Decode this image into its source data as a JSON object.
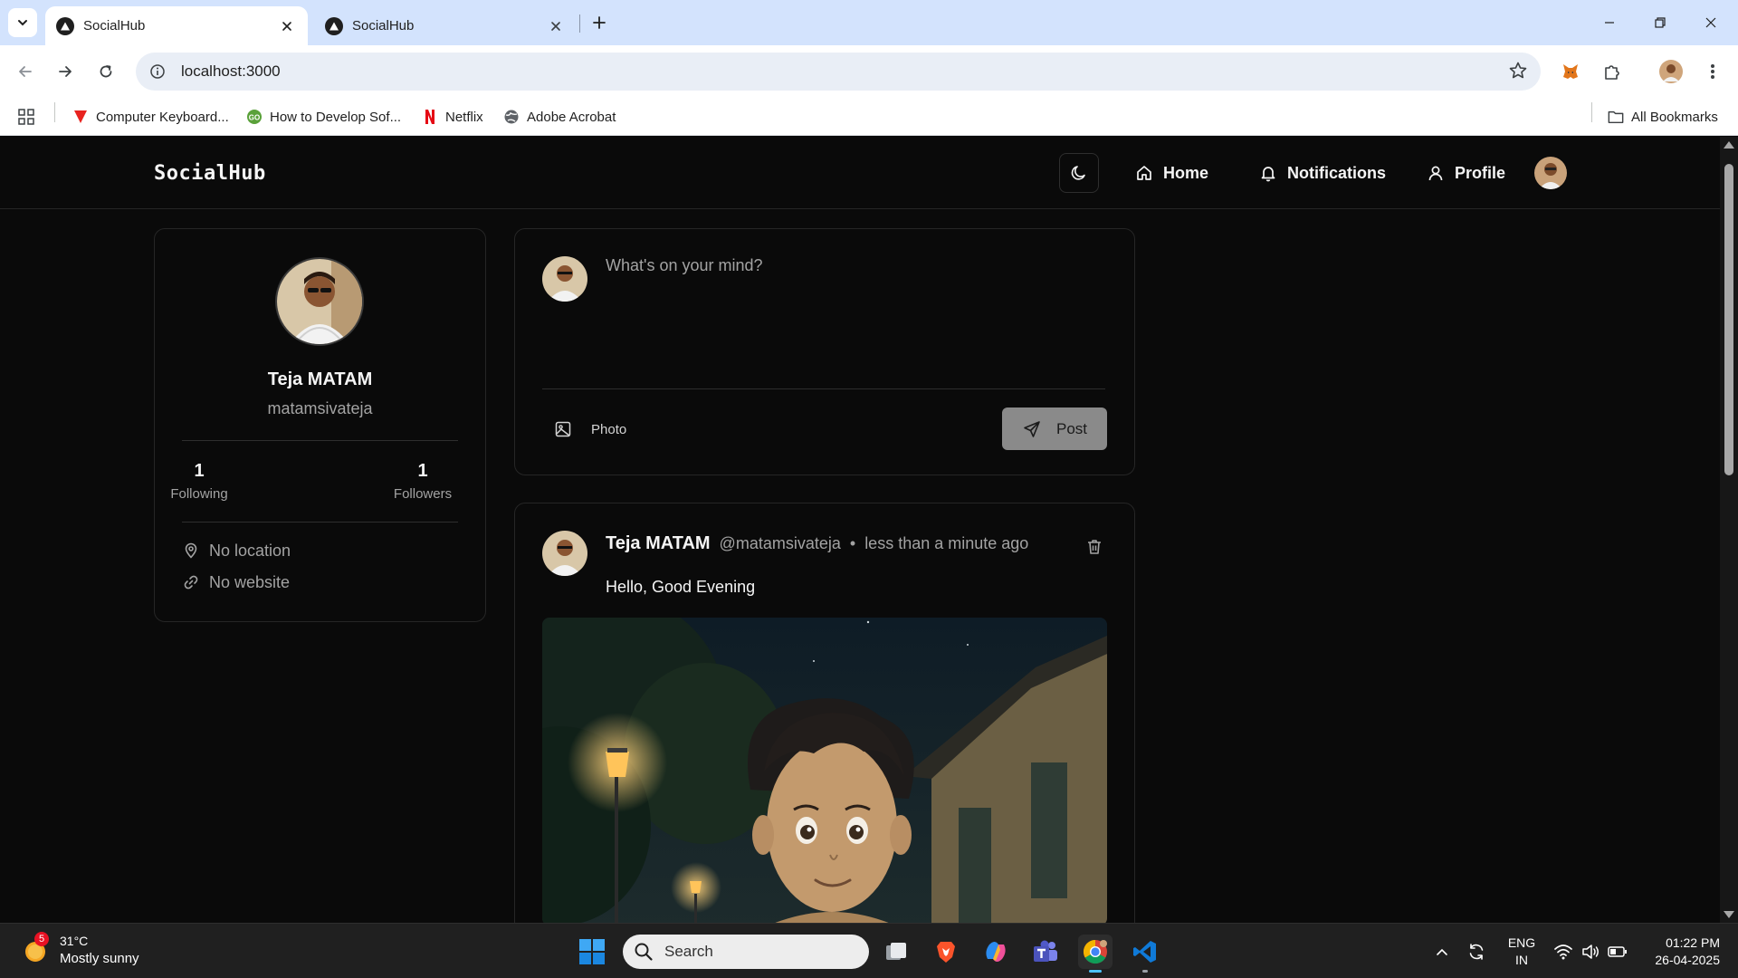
{
  "browser": {
    "tabs": [
      {
        "title": "SocialHub",
        "active": true
      },
      {
        "title": "SocialHub",
        "active": false
      }
    ],
    "url": "localhost:3000",
    "bookmarks": [
      {
        "label": "Computer Keyboard...",
        "icon": "vivaldi-icon",
        "color": "#e8231f"
      },
      {
        "label": "How to Develop Sof...",
        "icon": "site-icon",
        "color": "#5aa13a"
      },
      {
        "label": "Netflix",
        "icon": "netflix-icon",
        "color": "#e50914"
      },
      {
        "label": "Adobe Acrobat",
        "icon": "globe-icon",
        "color": "#5f6368"
      }
    ],
    "all_bookmarks_label": "All Bookmarks"
  },
  "app": {
    "logo": "SocialHub",
    "nav": {
      "home": "Home",
      "notifications": "Notifications",
      "profile": "Profile"
    }
  },
  "profile": {
    "name": "Teja MATAM",
    "handle": "matamsivateja",
    "following_count": "1",
    "following_label": "Following",
    "followers_count": "1",
    "followers_label": "Followers",
    "location": "No location",
    "website": "No website"
  },
  "composer": {
    "placeholder": "What's on your mind?",
    "photo_label": "Photo",
    "post_label": "Post"
  },
  "post": {
    "author": "Teja MATAM",
    "handle": "@matamsivateja",
    "separator": "•",
    "time": "less than a minute ago",
    "text": "Hello, Good Evening"
  },
  "taskbar": {
    "weather_badge": "5",
    "temperature": "31°C",
    "condition": "Mostly sunny",
    "search_placeholder": "Search",
    "lang_line1": "ENG",
    "lang_line2": "IN",
    "time": "01:22 PM",
    "date": "26-04-2025"
  },
  "colors": {
    "background": "#0a0a0a",
    "border": "#262626",
    "text_primary": "#f5f5f5",
    "text_muted": "#a3a3a3",
    "post_button": "#8a8a8a",
    "tabstrip": "#d3e3fd"
  }
}
